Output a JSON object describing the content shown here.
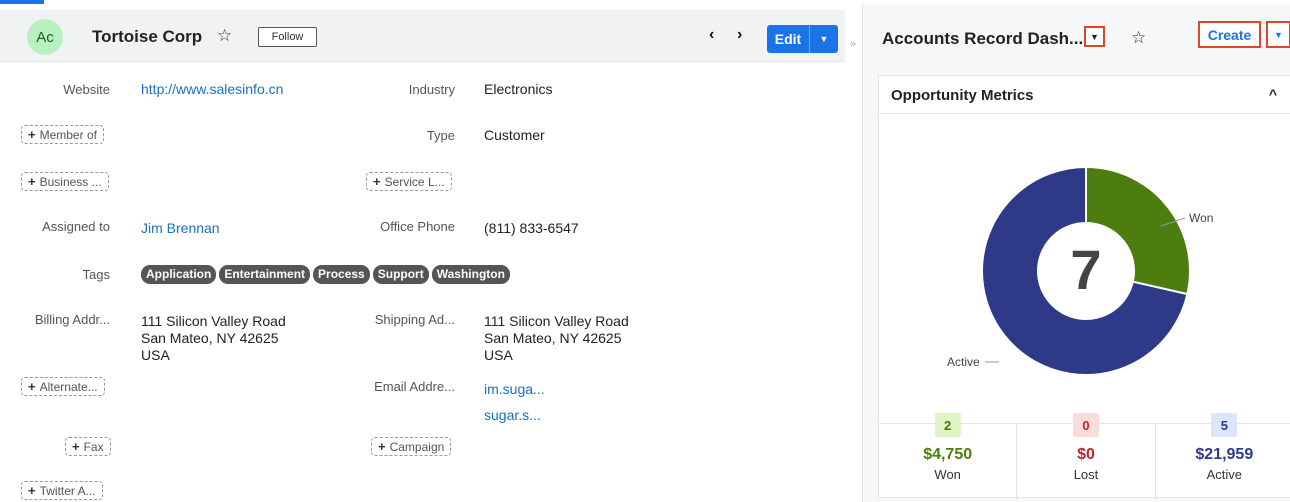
{
  "record": {
    "avatar_initials": "Ac",
    "name": "Tortoise Corp",
    "follow_label": "Follow",
    "edit_label": "Edit",
    "fields": {
      "website_label": "Website",
      "website_value": "http://www.salesinfo.cn",
      "industry_label": "Industry",
      "industry_value": "Electronics",
      "member_of_label": "Member of",
      "type_label": "Type",
      "type_value": "Customer",
      "business_label": "Business ...",
      "service_label": "Service L...",
      "assigned_label": "Assigned to",
      "assigned_value": "Jim Brennan",
      "office_phone_label": "Office Phone",
      "office_phone_value": "(811) 833-6547",
      "tags_label": "Tags",
      "billing_label": "Billing Addr...",
      "billing_line1": "111 Silicon Valley Road",
      "billing_line2": "San Mateo, NY 42625",
      "billing_line3": "USA",
      "shipping_label": "Shipping Ad...",
      "shipping_line1": "111 Silicon Valley Road",
      "shipping_line2": "San Mateo, NY 42625",
      "shipping_line3": "USA",
      "alternate_label": "Alternate...",
      "email_label": "Email Addre...",
      "email_1": "im.suga...",
      "email_2": "sugar.s...",
      "fax_label": "Fax",
      "campaign_label": "Campaign",
      "twitter_label": "Twitter A..."
    },
    "tags": [
      "Application",
      "Entertainment",
      "Process",
      "Support",
      "Washington"
    ]
  },
  "dashboard": {
    "title": "Accounts Record Dash...",
    "create_label": "Create",
    "dashlet_title": "Opportunity Metrics",
    "center_total": "7",
    "won_callout": "Won",
    "active_callout": "Active",
    "colors": {
      "won": "#4d7c0f",
      "active": "#2e3a87",
      "lost": "#c0262d"
    },
    "metrics": [
      {
        "count": "2",
        "amount": "$4,750",
        "label": "Won",
        "count_bg": "#dff5c6",
        "count_color": "#3f7a0c",
        "amount_color": "#4d7c0f"
      },
      {
        "count": "0",
        "amount": "$0",
        "label": "Lost",
        "count_bg": "#fbdcdc",
        "count_color": "#c0262d",
        "amount_color": "#c0262d"
      },
      {
        "count": "5",
        "amount": "$21,959",
        "label": "Active",
        "count_bg": "#dbe6fb",
        "count_color": "#2e3a87",
        "amount_color": "#2e3a87"
      }
    ]
  },
  "chart_data": {
    "type": "pie",
    "categories": [
      "Won",
      "Active"
    ],
    "values": [
      2,
      5
    ],
    "title": "",
    "center_label": "7"
  }
}
